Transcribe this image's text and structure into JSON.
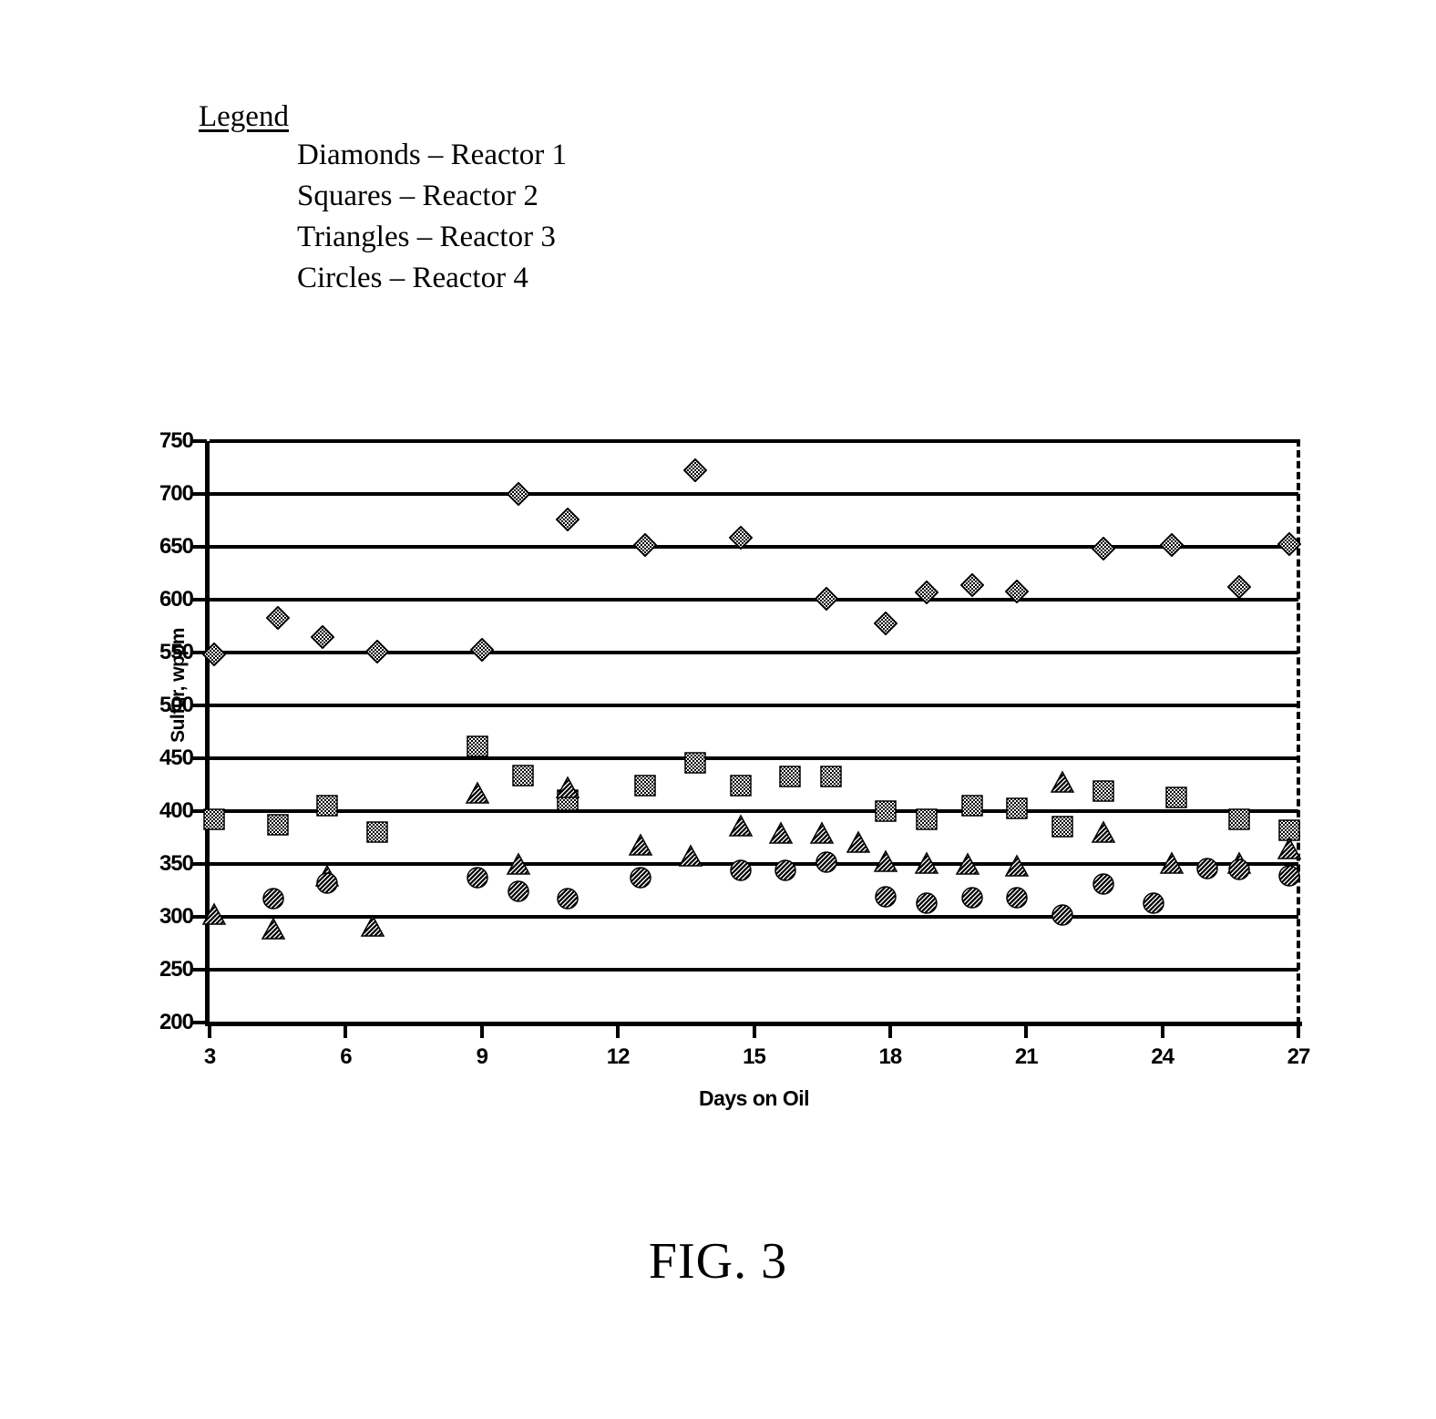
{
  "figure": {
    "caption": "FIG. 3"
  },
  "legend": {
    "title": "Legend",
    "entries": [
      "Diamonds – Reactor 1",
      "Squares – Reactor 2",
      "Triangles – Reactor 3",
      "Circles – Reactor 4"
    ]
  },
  "chart_data": {
    "type": "scatter",
    "title": "",
    "xlabel": "Days on Oil",
    "ylabel": "Sulfur, wppm",
    "xlim": [
      3,
      27
    ],
    "ylim": [
      200,
      750
    ],
    "xticks": [
      3,
      6,
      9,
      12,
      15,
      18,
      21,
      24,
      27
    ],
    "xtick_labels": [
      "3",
      "6",
      "9",
      "12",
      "15",
      "18",
      "21",
      "24",
      "27"
    ],
    "yticks": [
      200,
      250,
      300,
      350,
      400,
      450,
      500,
      550,
      600,
      650,
      700,
      750
    ],
    "ytick_labels": [
      "200",
      "250",
      "300",
      "350",
      "400",
      "450",
      "500",
      "550",
      "600",
      "650",
      "700",
      "750"
    ],
    "grid": "horizontal",
    "legend_position": "above-plot-external",
    "series": [
      {
        "name": "Reactor 1",
        "marker": "diamond",
        "points": [
          {
            "x": 3.1,
            "y": 548
          },
          {
            "x": 4.5,
            "y": 583
          },
          {
            "x": 5.5,
            "y": 565
          },
          {
            "x": 6.7,
            "y": 551
          },
          {
            "x": 9.0,
            "y": 553
          },
          {
            "x": 9.8,
            "y": 700
          },
          {
            "x": 10.9,
            "y": 676
          },
          {
            "x": 12.6,
            "y": 652
          },
          {
            "x": 13.7,
            "y": 722
          },
          {
            "x": 14.7,
            "y": 659
          },
          {
            "x": 16.6,
            "y": 601
          },
          {
            "x": 17.9,
            "y": 578
          },
          {
            "x": 18.8,
            "y": 607
          },
          {
            "x": 19.8,
            "y": 614
          },
          {
            "x": 20.8,
            "y": 608
          },
          {
            "x": 22.7,
            "y": 648
          },
          {
            "x": 24.2,
            "y": 652
          },
          {
            "x": 25.7,
            "y": 612
          },
          {
            "x": 26.8,
            "y": 653
          }
        ]
      },
      {
        "name": "Reactor 2",
        "marker": "square",
        "points": [
          {
            "x": 3.1,
            "y": 392
          },
          {
            "x": 4.5,
            "y": 387
          },
          {
            "x": 5.6,
            "y": 405
          },
          {
            "x": 6.7,
            "y": 380
          },
          {
            "x": 8.9,
            "y": 461
          },
          {
            "x": 9.9,
            "y": 434
          },
          {
            "x": 10.9,
            "y": 410
          },
          {
            "x": 12.6,
            "y": 424
          },
          {
            "x": 13.7,
            "y": 446
          },
          {
            "x": 14.7,
            "y": 424
          },
          {
            "x": 15.8,
            "y": 433
          },
          {
            "x": 16.7,
            "y": 433
          },
          {
            "x": 17.9,
            "y": 400
          },
          {
            "x": 18.8,
            "y": 392
          },
          {
            "x": 19.8,
            "y": 405
          },
          {
            "x": 20.8,
            "y": 403
          },
          {
            "x": 21.8,
            "y": 385
          },
          {
            "x": 22.7,
            "y": 419
          },
          {
            "x": 24.3,
            "y": 413
          },
          {
            "x": 25.7,
            "y": 392
          },
          {
            "x": 26.8,
            "y": 382
          }
        ]
      },
      {
        "name": "Reactor 3",
        "marker": "triangle",
        "points": [
          {
            "x": 3.1,
            "y": 303
          },
          {
            "x": 4.4,
            "y": 289
          },
          {
            "x": 5.6,
            "y": 339
          },
          {
            "x": 6.6,
            "y": 291
          },
          {
            "x": 8.9,
            "y": 417
          },
          {
            "x": 9.8,
            "y": 350
          },
          {
            "x": 10.9,
            "y": 422
          },
          {
            "x": 12.5,
            "y": 368
          },
          {
            "x": 13.6,
            "y": 358
          },
          {
            "x": 14.7,
            "y": 386
          },
          {
            "x": 15.6,
            "y": 379
          },
          {
            "x": 16.5,
            "y": 379
          },
          {
            "x": 17.3,
            "y": 371
          },
          {
            "x": 17.9,
            "y": 353
          },
          {
            "x": 18.8,
            "y": 351
          },
          {
            "x": 19.7,
            "y": 350
          },
          {
            "x": 20.8,
            "y": 348
          },
          {
            "x": 21.8,
            "y": 428
          },
          {
            "x": 22.7,
            "y": 380
          },
          {
            "x": 24.2,
            "y": 351
          },
          {
            "x": 25.7,
            "y": 351
          },
          {
            "x": 26.8,
            "y": 365
          }
        ]
      },
      {
        "name": "Reactor 4",
        "marker": "circle",
        "points": [
          {
            "x": 4.4,
            "y": 317
          },
          {
            "x": 5.6,
            "y": 332
          },
          {
            "x": 8.9,
            "y": 337
          },
          {
            "x": 9.8,
            "y": 324
          },
          {
            "x": 10.9,
            "y": 317
          },
          {
            "x": 12.5,
            "y": 337
          },
          {
            "x": 14.7,
            "y": 344
          },
          {
            "x": 15.7,
            "y": 344
          },
          {
            "x": 16.6,
            "y": 352
          },
          {
            "x": 17.9,
            "y": 319
          },
          {
            "x": 18.8,
            "y": 313
          },
          {
            "x": 19.8,
            "y": 318
          },
          {
            "x": 20.8,
            "y": 318
          },
          {
            "x": 21.8,
            "y": 302
          },
          {
            "x": 22.7,
            "y": 331
          },
          {
            "x": 23.8,
            "y": 313
          },
          {
            "x": 25.0,
            "y": 346
          },
          {
            "x": 25.7,
            "y": 345
          },
          {
            "x": 26.8,
            "y": 339
          }
        ]
      }
    ]
  }
}
